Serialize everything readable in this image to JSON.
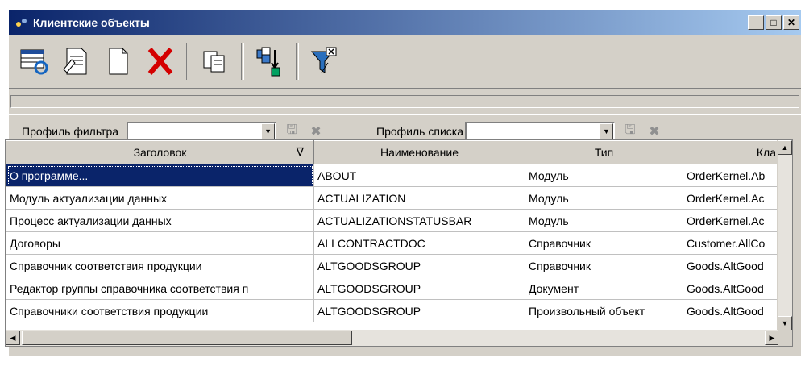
{
  "window": {
    "title": "Клиентские объекты"
  },
  "toolbar": {
    "icons": [
      "refresh-table-icon",
      "edit-document-icon",
      "new-document-icon",
      "delete-icon",
      "copy-icon",
      "export-icon",
      "clear-filter-icon"
    ]
  },
  "filter": {
    "filter_profile_label": "Профиль фильтра",
    "filter_profile_value": "",
    "list_profile_label": "Профиль списка",
    "list_profile_value": ""
  },
  "table": {
    "columns": [
      "Заголовок",
      "Наименование",
      "Тип",
      "Кла"
    ],
    "sort_indicator": "∇",
    "rows": [
      [
        "О программе...",
        "ABOUT",
        "Модуль",
        "OrderKernel.Ab"
      ],
      [
        "Модуль актуализации данных",
        "ACTUALIZATION",
        "Модуль",
        "OrderKernel.Ac"
      ],
      [
        "Процесс актуализации данных",
        "ACTUALIZATIONSTATUSBAR",
        "Модуль",
        "OrderKernel.Ac"
      ],
      [
        "Договоры",
        "ALLCONTRACTDOC",
        "Справочник",
        "Customer.AllCo"
      ],
      [
        "Справочник соответствия продукции",
        "ALTGOODSGROUP",
        "Справочник",
        "Goods.AltGood"
      ],
      [
        "Редактор группы справочника соответствия п",
        "ALTGOODSGROUP",
        "Документ",
        "Goods.AltGood"
      ],
      [
        "Справочники соответствия продукции",
        "ALTGOODSGROUP",
        "Произвольный объект",
        "Goods.AltGood"
      ]
    ],
    "selected_row": 0
  }
}
